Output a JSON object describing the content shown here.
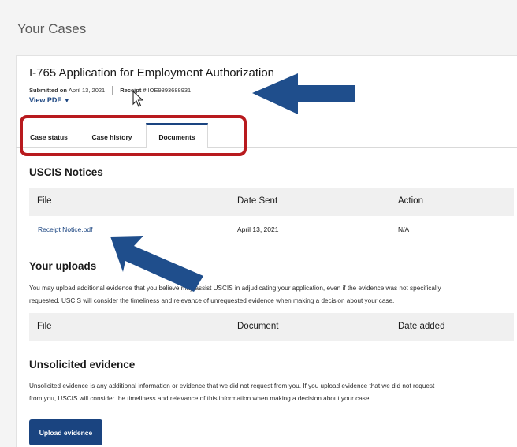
{
  "page": {
    "title": "Your Cases"
  },
  "case": {
    "title": "I-765 Application for Employment Authorization",
    "submitted_label": "Submitted on",
    "submitted_date": "April 13, 2021",
    "receipt_label": "Receipt #",
    "receipt_number": "IOE9893688931",
    "view_pdf_label": "View PDF"
  },
  "tabs": [
    {
      "label": "Case status",
      "active": false
    },
    {
      "label": "Case history",
      "active": false
    },
    {
      "label": "Documents",
      "active": true
    }
  ],
  "notices": {
    "heading": "USCIS Notices",
    "columns": [
      "File",
      "Date Sent",
      "Action"
    ],
    "rows": [
      {
        "file": "Receipt Notice.pdf",
        "date_sent": "April 13, 2021",
        "action": "N/A"
      }
    ]
  },
  "uploads": {
    "heading": "Your uploads",
    "description_line1": "You may upload additional evidence that you believe may assist USCIS in adjudicating your application, even if the evidence was not specifically",
    "description_line2": "requested. USCIS will consider the timeliness and relevance of unrequested evidence when making a decision about your case.",
    "columns": [
      "File",
      "Document",
      "Date added"
    ]
  },
  "unsolicited": {
    "heading": "Unsolicited evidence",
    "description_line1": "Unsolicited evidence is any additional information or evidence that we did not request from you. If you upload evidence that we did not request",
    "description_line2": "from you, USCIS will consider the timeliness and relevance of this information when making a decision about your case.",
    "button_label": "Upload evidence"
  },
  "annotations": {
    "highlight_color": "#b81a1e",
    "arrow_color": "#1f4e8c"
  },
  "colors": {
    "primary": "#1a4480"
  }
}
